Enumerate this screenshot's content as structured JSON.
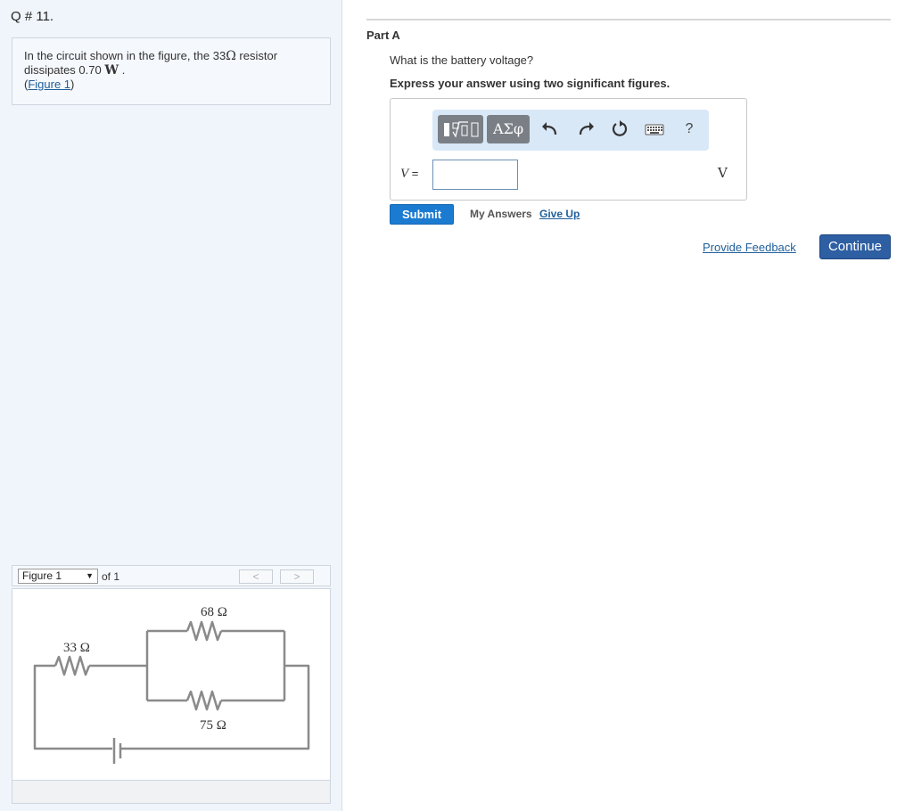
{
  "question_number": "Q # 11.",
  "problem": {
    "text_before": "In the circuit shown in the figure, the 33",
    "ohm_symbol": "Ω",
    "text_middle": " resistor dissipates 0.70 ",
    "watt_unit": "W",
    "text_after": " .",
    "figure_link_open": "(",
    "figure_link": "Figure 1",
    "figure_link_close": ")"
  },
  "figure_nav": {
    "selected": "Figure 1",
    "of_text": "of 1",
    "prev": "<",
    "next": ">"
  },
  "circuit": {
    "r1_label": "33 Ω",
    "r2_label": "68 Ω",
    "r3_label": "75 Ω"
  },
  "part": {
    "title": "Part A",
    "question": "What is the battery voltage?",
    "instruction": "Express your answer using two significant figures."
  },
  "toolbar": {
    "greek_label": "ΑΣφ",
    "help_label": "?",
    "icons": [
      "templates-icon",
      "greek-icon",
      "undo-icon",
      "redo-icon",
      "reset-icon",
      "keyboard-icon",
      "help-icon"
    ]
  },
  "answer": {
    "variable": "V",
    "equals": " =",
    "value": "",
    "unit": "V"
  },
  "actions": {
    "submit": "Submit",
    "my_answers": "My Answers",
    "give_up": "Give Up",
    "provide_feedback": "Provide Feedback",
    "continue": "Continue"
  },
  "colors": {
    "submit_bg": "#1b7bd1",
    "continue_bg": "#2e5fa3",
    "link": "#1f5f9a",
    "left_pane_bg": "#f0f5fb",
    "toolbar_bg": "#d9e8f7"
  }
}
